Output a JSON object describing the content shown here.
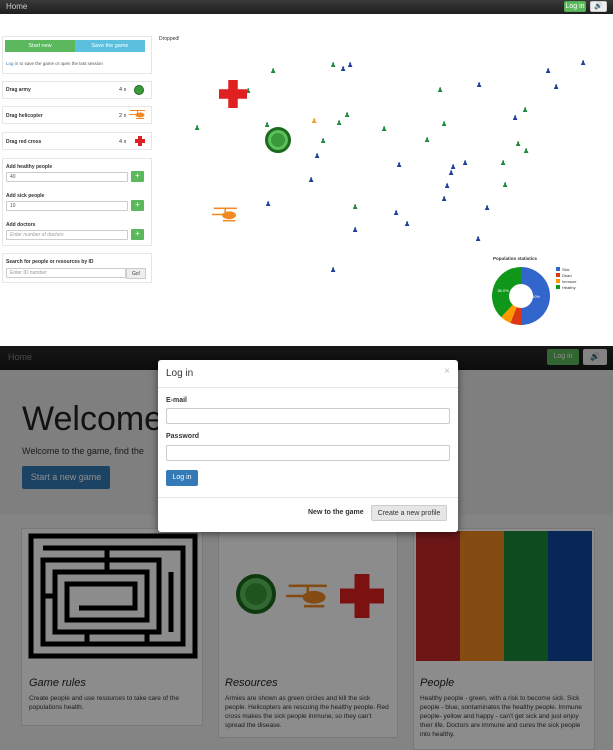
{
  "nav": {
    "home": "Home",
    "login": "Log in",
    "sound_icon": "speaker-icon"
  },
  "top": {
    "tab_start": "Start new",
    "tab_save": "Save the game",
    "login_link": "Log in",
    "login_rest": " to save the game or open the last session",
    "drag_army": "Drag army",
    "army_count": "4 x",
    "drag_helicopter": "Drag helicopter",
    "heli_count": "2 x",
    "drag_redcross": "Drag red cross",
    "cross_count": "4 x",
    "add_healthy": "Add healthy people",
    "healthy_val": "40",
    "add_sick": "Add sick people",
    "sick_val": "10",
    "add_doctors": "Add doctors",
    "doctors_ph": "Enter number of doctors",
    "search_label": "Search for people or resources by ID",
    "search_ph": "Enter ID number",
    "go": "Go!",
    "dropped": "Dropped!",
    "stats_title": "Population statistics",
    "legend": [
      "Sick",
      "Dead",
      "Immune",
      "Healthy"
    ],
    "pie_labels": {
      "healthy": "38.0%",
      "sick": "50%"
    }
  },
  "chart_data": {
    "type": "pie",
    "title": "Population statistics",
    "categories": [
      "Sick",
      "Dead",
      "Immune",
      "Healthy"
    ],
    "values": [
      50,
      6,
      6,
      38
    ],
    "colors": [
      "#3366cc",
      "#dc3912",
      "#ff9900",
      "#109618"
    ]
  },
  "modal": {
    "title": "Log in",
    "close": "×",
    "email": "E-mail",
    "password": "Password",
    "login_btn": "Log in",
    "new_game": "New to the game",
    "create": "Create a new profile"
  },
  "bottom": {
    "home": "Home",
    "login": "Log in",
    "welcome": "Welcome!",
    "subtitle": "Welcome to the game, find the",
    "start": "Start a new game",
    "card1_title": "Game rules",
    "card1_text": "Create people and use resources to take care of the populations health.",
    "card2_title": "Resources",
    "card2_text": "Armies are shown as green circles and kill the sick people. Helicopters are rescuing the healthy people. Red cross makes the sick people immune, so they can't spread the disease.",
    "card3_title": "People",
    "card3_text": "Healthy people - green, with a risk to become sick. Sick people - blue, sontaminates the healthy people. Immune people- yellow and happy - can't get sick and just enjoy their life. Doctors are immune and cures the sick people into healthy."
  }
}
